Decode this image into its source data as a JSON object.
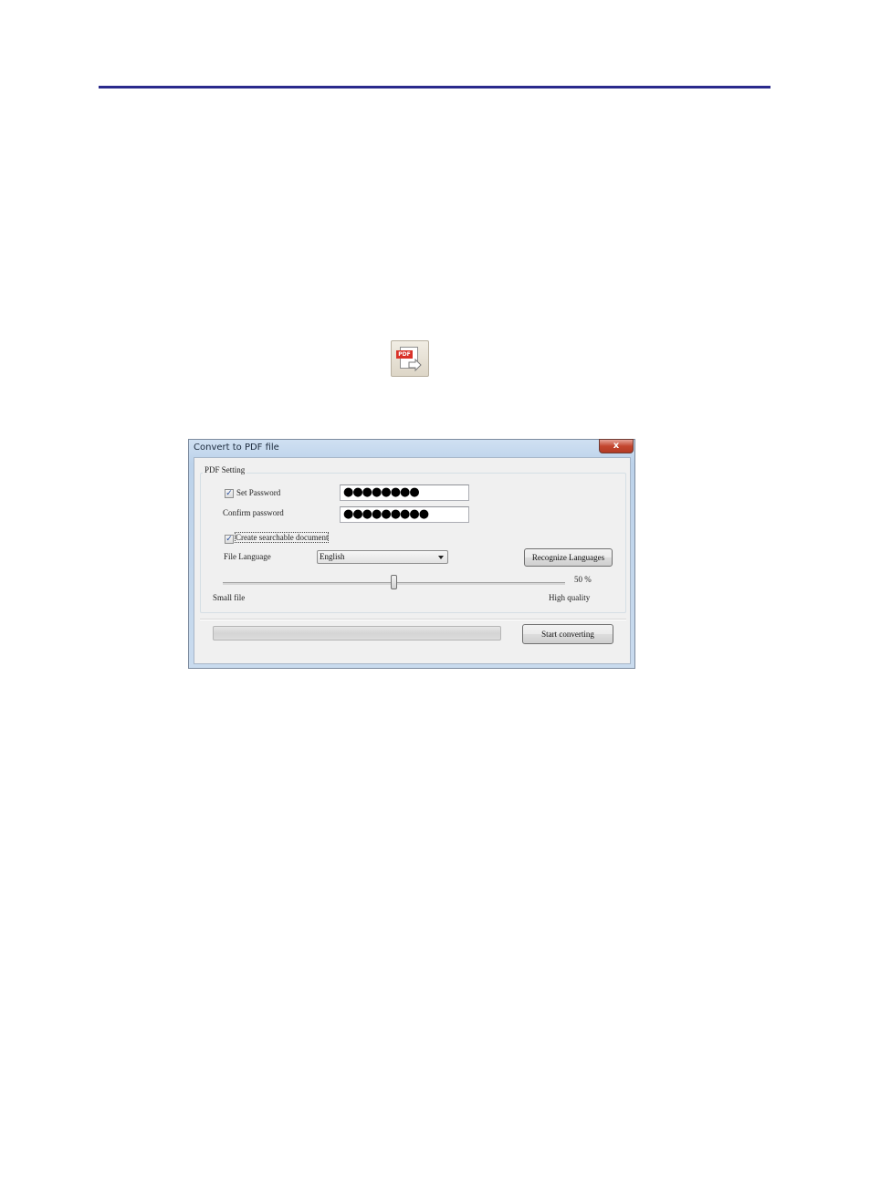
{
  "toolbar": {
    "icon": "pdf-convert-icon",
    "badge": "PDF"
  },
  "dialog": {
    "title": "Convert to PDF file",
    "close_glyph": "x",
    "group_title": "PDF Setting",
    "set_password": {
      "label": "Set Password",
      "checked": true,
      "value": "●●●●●●●●"
    },
    "confirm_password": {
      "label": "Confirm password",
      "value": "●●●●●●●●●"
    },
    "searchable": {
      "label": "Create searchable document",
      "checked": true
    },
    "file_language": {
      "label": "File Language",
      "selected": "English"
    },
    "recognize_button": "Recognize Languages",
    "quality": {
      "value_label": "50 %",
      "value": 50,
      "min_label": "Small file",
      "max_label": "High quality"
    },
    "progress": {
      "value": 0
    },
    "start_button": "Start converting",
    "check_glyph": "✓"
  }
}
